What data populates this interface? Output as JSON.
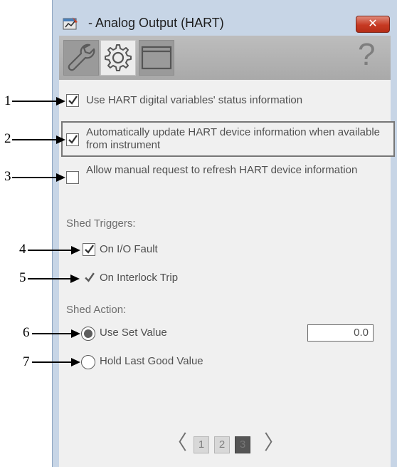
{
  "window": {
    "title": "- Analog Output (HART)",
    "close_label": "✕"
  },
  "tabs": [
    {
      "name": "wrench-icon"
    },
    {
      "name": "gear-icon",
      "active": true
    },
    {
      "name": "faceplate-icon"
    }
  ],
  "help_label": "?",
  "options": {
    "hart_status": {
      "label": "Use HART digital variables' status information",
      "checked": true
    },
    "auto_update": {
      "label": "Automatically update HART device information when available from instrument",
      "checked": true
    },
    "manual_refresh": {
      "label": "Allow manual request to refresh HART device information",
      "checked": false
    }
  },
  "shed_triggers": {
    "heading": "Shed Triggers:",
    "io_fault": {
      "label": "On I/O Fault",
      "checked": true
    },
    "interlock_trip": {
      "label": "On Interlock Trip",
      "checked": true
    }
  },
  "shed_action": {
    "heading": "Shed Action:",
    "use_set_value": {
      "label": "Use Set Value",
      "selected": true
    },
    "hold_last": {
      "label": "Hold Last Good Value",
      "selected": false
    },
    "set_value": "0.0"
  },
  "pager": {
    "prev": "〈",
    "next": "〉",
    "pages": [
      "1",
      "2",
      "3"
    ],
    "current": "3"
  },
  "callouts": [
    "1",
    "2",
    "3",
    "4",
    "5",
    "6",
    "7"
  ],
  "colors": {
    "window_frame": "#c7d5e6",
    "close_button": "#c73a23",
    "panel": "#f0f0f0"
  }
}
